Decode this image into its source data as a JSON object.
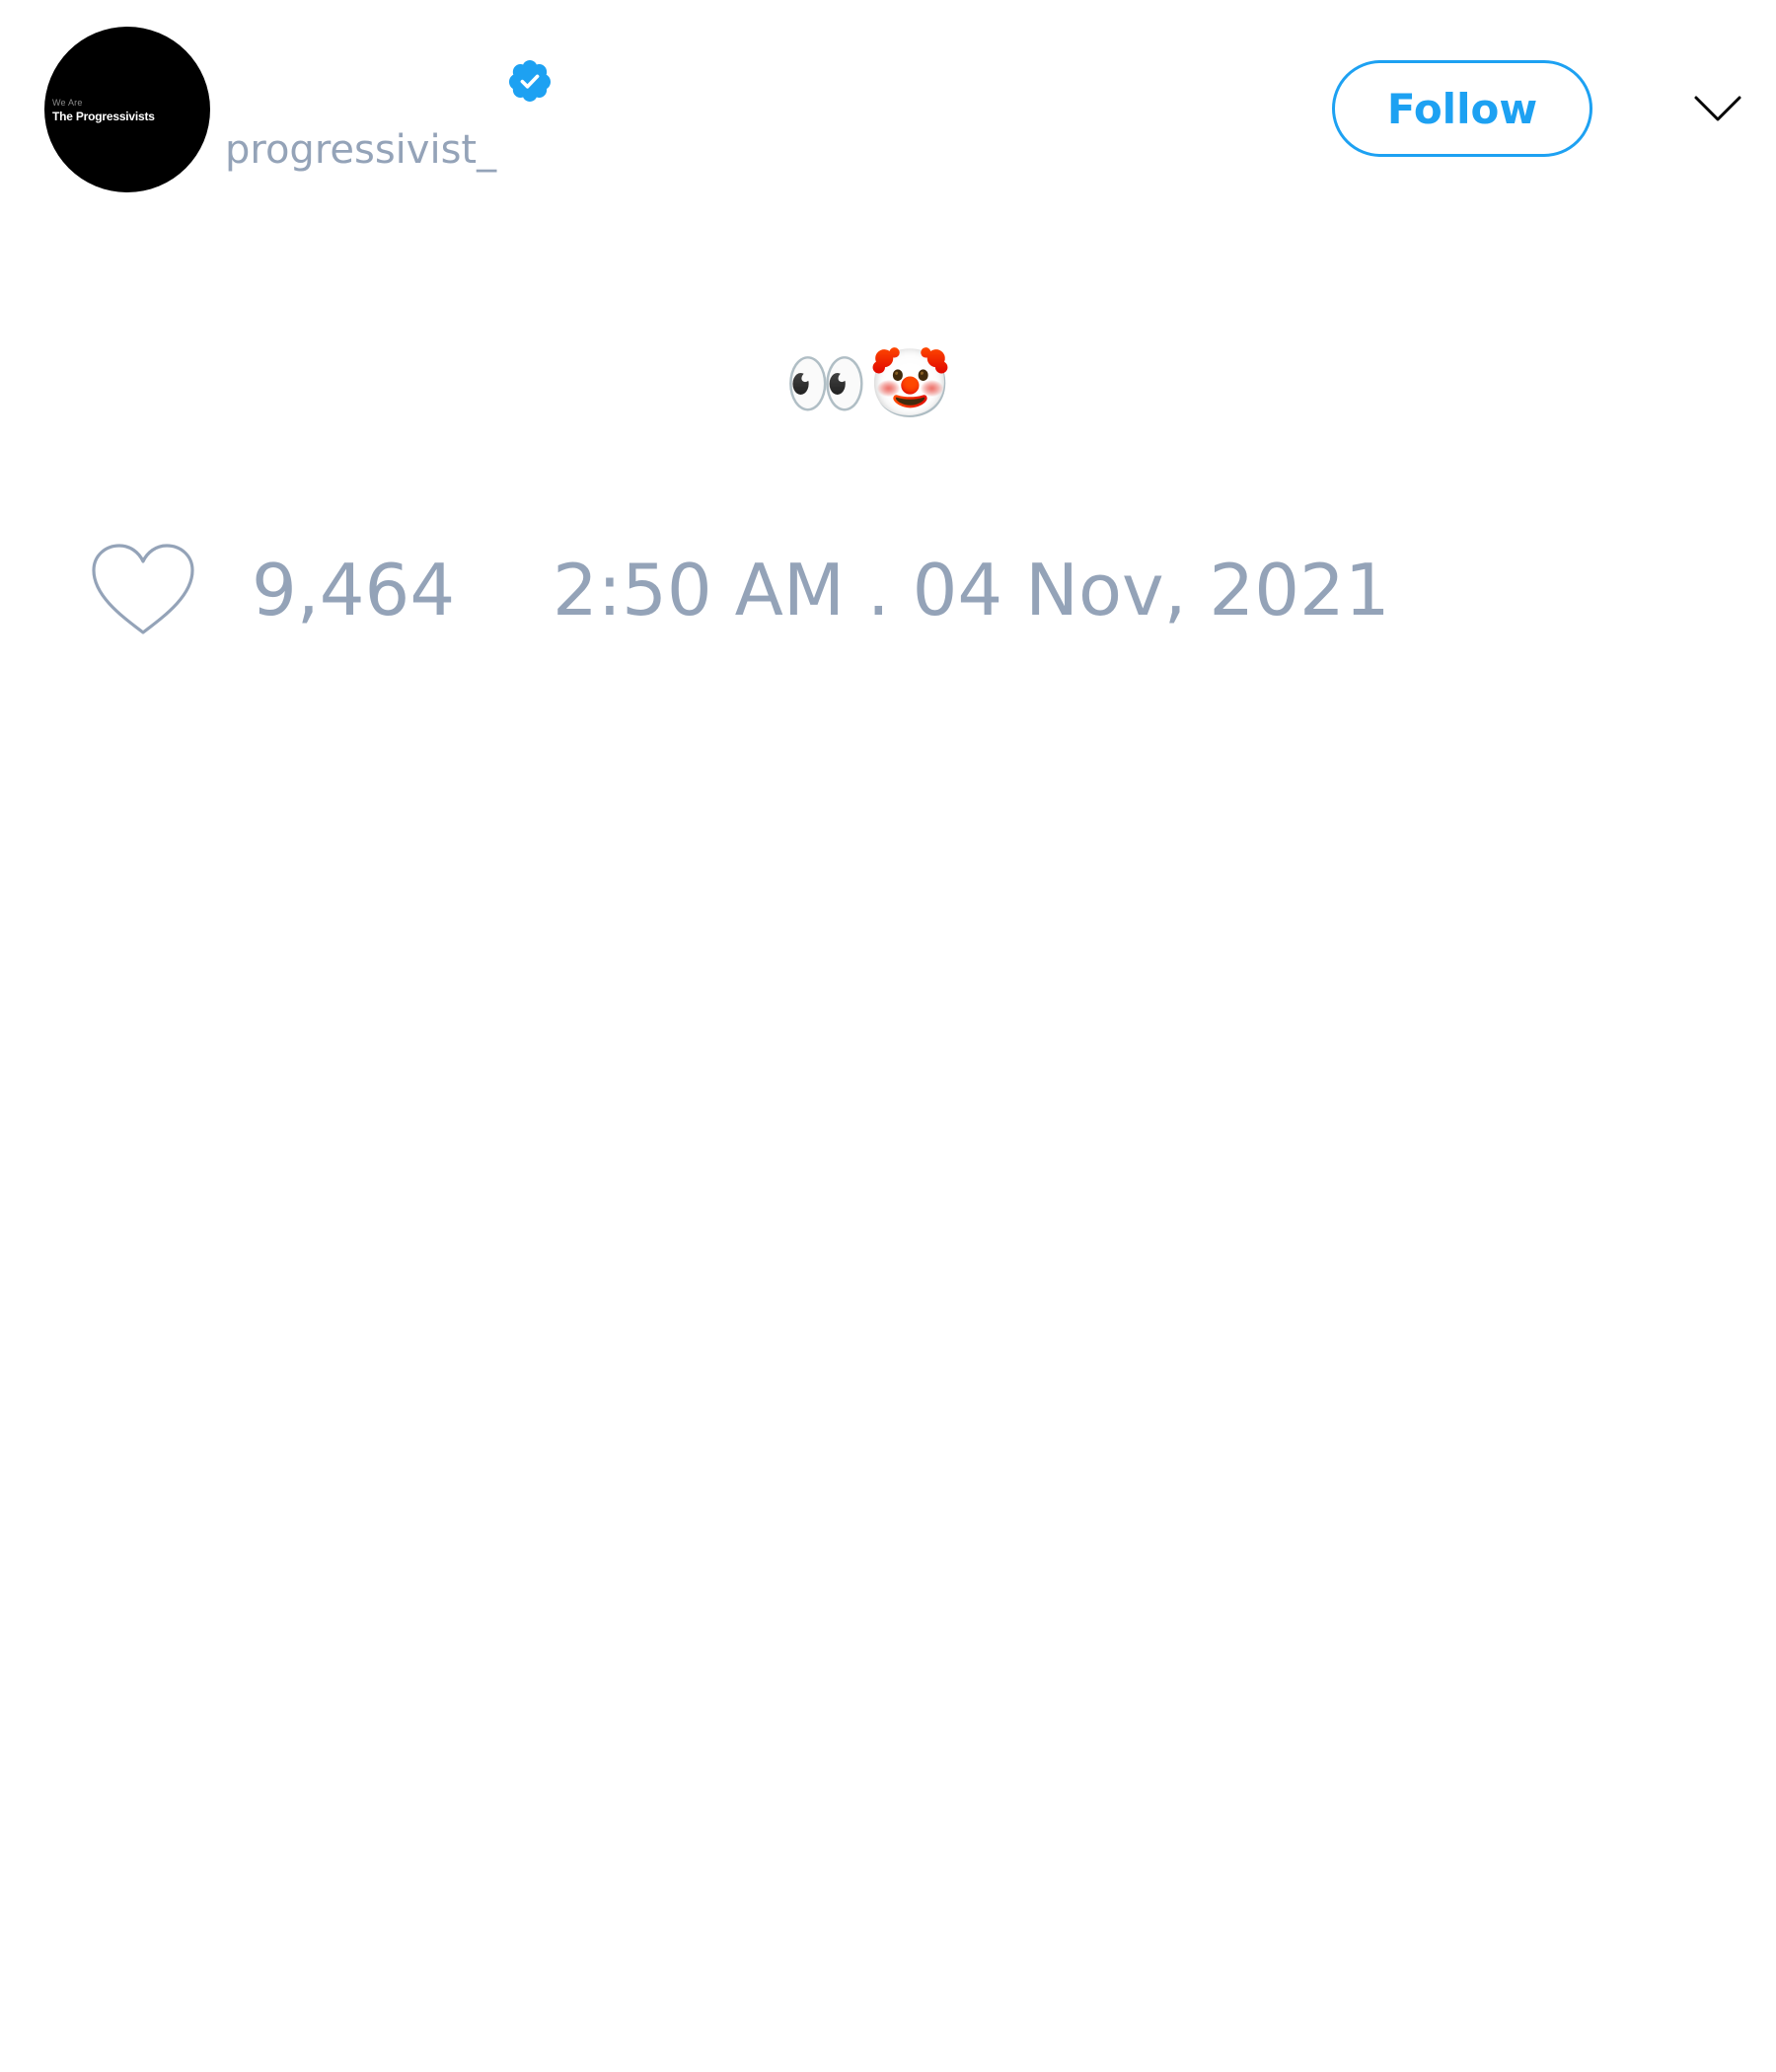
{
  "colors": {
    "accent": "#1da1f2",
    "muted_text": "#94a3b8",
    "background": "#ffffff",
    "avatar_bg": "#000000"
  },
  "author": {
    "avatar_text_small": "We Are",
    "avatar_text_main": "The Progressivists",
    "handle": "progressivist_",
    "verified_icon": "verified-badge-icon"
  },
  "header": {
    "follow_label": "Follow",
    "menu_icon": "chevron-down-icon"
  },
  "tweet": {
    "text": "👀🤡"
  },
  "footer": {
    "like_icon": "heart-outline-icon",
    "like_count": "9,464",
    "timestamp": "2:50 AM . 04 Nov, 2021"
  }
}
